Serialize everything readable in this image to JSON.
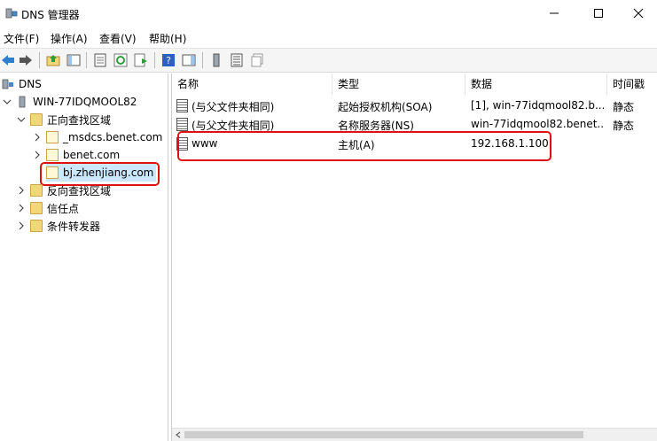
{
  "window": {
    "title": "DNS 管理器"
  },
  "menu": [
    "文件(F)",
    "操作(A)",
    "查看(V)",
    "帮助(H)"
  ],
  "tree": {
    "root": "DNS",
    "server": "WIN-77IDQMOOL82",
    "forward_zones": "正向查找区域",
    "zones": [
      "_msdcs.benet.com",
      "benet.com",
      "bj.zhenjiang.com"
    ],
    "reverse_zones": "反向查找区域",
    "trust_points": "信任点",
    "conditional_forwarders": "条件转发器",
    "selected": "bj.zhenjiang.com"
  },
  "list": {
    "columns": [
      "名称",
      "类型",
      "数据",
      "时间戳"
    ],
    "rows": [
      {
        "name": "(与父文件夹相同)",
        "type": "起始授权机构(SOA)",
        "data": "[1], win-77idqmool82.b...",
        "timestamp": "静态"
      },
      {
        "name": "(与父文件夹相同)",
        "type": "名称服务器(NS)",
        "data": "win-77idqmool82.benet...",
        "timestamp": "静态"
      },
      {
        "name": "www",
        "type": "主机(A)",
        "data": "192.168.1.100",
        "timestamp": ""
      }
    ]
  },
  "accent_color": "#e01010"
}
